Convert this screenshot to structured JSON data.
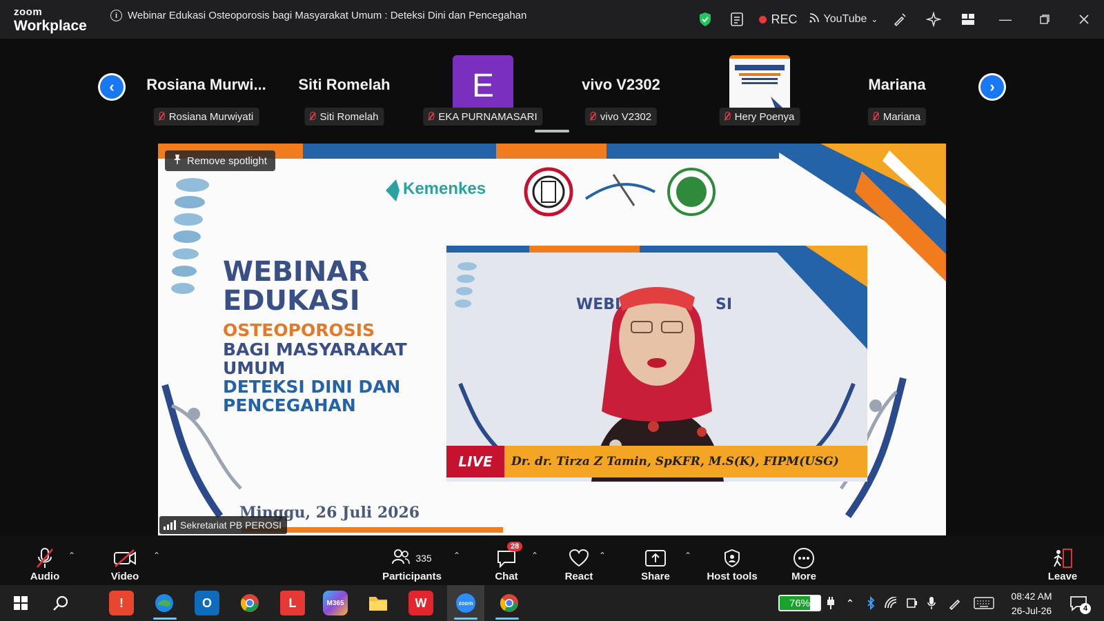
{
  "app": {
    "brand_small": "zoom",
    "brand_large": "Workplace"
  },
  "meeting": {
    "title": "Webinar Edukasi Osteoporosis bagi Masyarakat Umum : Deteksi Dini dan Pencegahan"
  },
  "titlebar": {
    "rec_label": "REC",
    "stream_label": "YouTube"
  },
  "gallery": {
    "tiles": [
      {
        "big": "Rosiana  Murwi...",
        "tag": "Rosiana Murwiyati"
      },
      {
        "big": "Siti Romelah",
        "tag": "Siti Romelah"
      },
      {
        "avatar": "E",
        "tag": "EKA PURNAMASARI"
      },
      {
        "big": "vivo V2302",
        "tag": "vivo V2302"
      },
      {
        "tag": "Hery Poenya"
      },
      {
        "big": "Mariana",
        "tag": "Mariana"
      }
    ]
  },
  "main": {
    "spotlight_label": "Remove spotlight",
    "source_name": "Sekretariat PB PEROSI",
    "slide": {
      "line1": "WEBINAR",
      "line2": "EDUKASI",
      "line3": "OSTEOPOROSIS",
      "line4": "BAGI MASYARAKAT",
      "line5": "UMUM",
      "line6": "DETEKSI DINI DAN",
      "line7": "PENCEGAHAN",
      "logo_text": "Kemenkes",
      "date": "Minggu, 26 Juli 2026",
      "live_label": "LIVE",
      "speaker": "Dr. dr. Tirza Z Tamin, SpKFR, M.S(K), FIPM(USG)"
    }
  },
  "toolbar": {
    "audio": "Audio",
    "video": "Video",
    "participants": "Participants",
    "participants_count": "335",
    "chat": "Chat",
    "chat_badge": "28",
    "react": "React",
    "share": "Share",
    "host_tools": "Host tools",
    "more": "More",
    "leave": "Leave"
  },
  "taskbar": {
    "battery": "76%",
    "time": "08:42 AM",
    "date": "26-Jul-26",
    "notifications": "4"
  },
  "colors": {
    "accent": "#1877f2",
    "rec": "#e5383b",
    "avatar_e": "#7b2fbf",
    "live_orange": "#f5a524"
  }
}
